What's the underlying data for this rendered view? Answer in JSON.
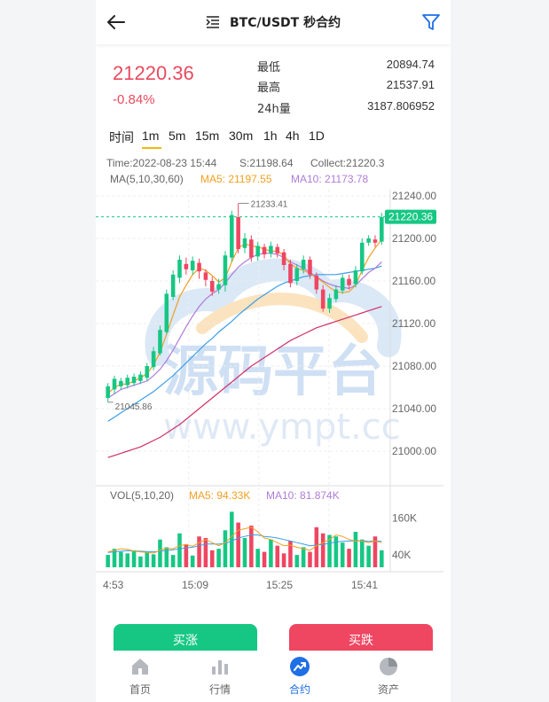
{
  "header": {
    "title": "BTC/USDT 秒合约"
  },
  "price": {
    "last": "21220.36",
    "change": "-0.84%",
    "low_label": "最低",
    "low": "20894.74",
    "high_label": "最高",
    "high": "21537.91",
    "vol_label": "24h量",
    "vol": "3187.806952"
  },
  "tabs": [
    "时间",
    "1m",
    "5m",
    "15m",
    "30m",
    "1h",
    "4h",
    "1D"
  ],
  "active_tab": "1m",
  "colors": {
    "up": "#16c784",
    "down": "#ef4662",
    "ma5": "#f0a020",
    "ma10": "#b07cd8",
    "ma30": "#3b9de8",
    "ma60": "#d0306a",
    "accent": "#1f6fe5",
    "tab_underline": "#f0b90b"
  },
  "chart_info": {
    "time": "Time:2022-08-23 15:44",
    "s": "S:21198.64",
    "collect": "Collect:21220.3",
    "ma_title": "MA(5,10,30,60)",
    "ma5": "MA5: 21197.55",
    "ma10": "MA10: 21173.78",
    "high_mark": "21233.41",
    "low_mark": "21045.86",
    "current_price_tag": "21220.36"
  },
  "chart_data": {
    "type": "candlestick",
    "y_ticks": [
      "21240.00",
      "21200.00",
      "21160.00",
      "21120.00",
      "21080.00",
      "21040.00",
      "21000.00"
    ],
    "x_ticks": [
      "4:53",
      "15:09",
      "15:25",
      "15:41"
    ],
    "ylim": [
      21000,
      21240
    ],
    "candles": [
      {
        "o": 21050,
        "c": 21061,
        "h": 21064,
        "l": 21046
      },
      {
        "o": 21058,
        "c": 21068,
        "h": 21071,
        "l": 21054
      },
      {
        "o": 21061,
        "c": 21066,
        "h": 21069,
        "l": 21058
      },
      {
        "o": 21062,
        "c": 21069,
        "h": 21072,
        "l": 21059
      },
      {
        "o": 21064,
        "c": 21070,
        "h": 21073,
        "l": 21061
      },
      {
        "o": 21066,
        "c": 21072,
        "h": 21075,
        "l": 21063
      },
      {
        "o": 21069,
        "c": 21080,
        "h": 21083,
        "l": 21066
      },
      {
        "o": 21079,
        "c": 21094,
        "h": 21098,
        "l": 21076
      },
      {
        "o": 21092,
        "c": 21114,
        "h": 21118,
        "l": 21090
      },
      {
        "o": 21112,
        "c": 21148,
        "h": 21152,
        "l": 21110
      },
      {
        "o": 21145,
        "c": 21166,
        "h": 21170,
        "l": 21142
      },
      {
        "o": 21163,
        "c": 21180,
        "h": 21184,
        "l": 21158
      },
      {
        "o": 21176,
        "c": 21171,
        "h": 21182,
        "l": 21166
      },
      {
        "o": 21170,
        "c": 21179,
        "h": 21183,
        "l": 21166
      },
      {
        "o": 21177,
        "c": 21169,
        "h": 21181,
        "l": 21162
      },
      {
        "o": 21168,
        "c": 21161,
        "h": 21171,
        "l": 21155
      },
      {
        "o": 21160,
        "c": 21150,
        "h": 21164,
        "l": 21146
      },
      {
        "o": 21152,
        "c": 21157,
        "h": 21162,
        "l": 21148
      },
      {
        "o": 21156,
        "c": 21184,
        "h": 21188,
        "l": 21150
      },
      {
        "o": 21182,
        "c": 21222,
        "h": 21226,
        "l": 21178
      },
      {
        "o": 21220,
        "c": 21190,
        "h": 21233,
        "l": 21186
      },
      {
        "o": 21191,
        "c": 21200,
        "h": 21205,
        "l": 21186
      },
      {
        "o": 21199,
        "c": 21182,
        "h": 21203,
        "l": 21178
      },
      {
        "o": 21183,
        "c": 21193,
        "h": 21197,
        "l": 21179
      },
      {
        "o": 21192,
        "c": 21185,
        "h": 21195,
        "l": 21181
      },
      {
        "o": 21186,
        "c": 21193,
        "h": 21197,
        "l": 21182
      },
      {
        "o": 21192,
        "c": 21186,
        "h": 21195,
        "l": 21182
      },
      {
        "o": 21187,
        "c": 21175,
        "h": 21190,
        "l": 21170
      },
      {
        "o": 21176,
        "c": 21158,
        "h": 21180,
        "l": 21154
      },
      {
        "o": 21160,
        "c": 21172,
        "h": 21176,
        "l": 21156
      },
      {
        "o": 21171,
        "c": 21180,
        "h": 21184,
        "l": 21167
      },
      {
        "o": 21180,
        "c": 21166,
        "h": 21183,
        "l": 21162
      },
      {
        "o": 21165,
        "c": 21152,
        "h": 21168,
        "l": 21148
      },
      {
        "o": 21152,
        "c": 21134,
        "h": 21156,
        "l": 21131
      },
      {
        "o": 21134,
        "c": 21144,
        "h": 21148,
        "l": 21130
      },
      {
        "o": 21143,
        "c": 21152,
        "h": 21156,
        "l": 21140
      },
      {
        "o": 21151,
        "c": 21163,
        "h": 21166,
        "l": 21148
      },
      {
        "o": 21162,
        "c": 21156,
        "h": 21166,
        "l": 21152
      },
      {
        "o": 21157,
        "c": 21170,
        "h": 21174,
        "l": 21154
      },
      {
        "o": 21169,
        "c": 21196,
        "h": 21200,
        "l": 21166
      },
      {
        "o": 21196,
        "c": 21200,
        "h": 21203,
        "l": 21193
      },
      {
        "o": 21199,
        "c": 21196,
        "h": 21203,
        "l": 21192
      },
      {
        "o": 21197,
        "c": 21220,
        "h": 21224,
        "l": 21194
      }
    ],
    "ma5": [
      21054,
      21060,
      21063,
      21063,
      21066,
      21069,
      21073,
      21081,
      21093,
      21110,
      21128,
      21145,
      21156,
      21166,
      21172,
      21170,
      21165,
      21159,
      21163,
      21178,
      21191,
      21195,
      21193,
      21192,
      21190,
      21188,
      21188,
      21184,
      21176,
      21172,
      21170,
      21167,
      21163,
      21159,
      21154,
      21150,
      21149,
      21150,
      21156,
      21170,
      21182,
      21191,
      21199
    ],
    "ma10": [
      21050,
      21054,
      21058,
      21060,
      21062,
      21064,
      21066,
      21071,
      21077,
      21085,
      21095,
      21106,
      21117,
      21127,
      21136,
      21143,
      21148,
      21152,
      21158,
      21166,
      21173,
      21178,
      21182,
      21185,
      21186,
      21186,
      21185,
      21182,
      21178,
      21175,
      21172,
      21168,
      21164,
      21160,
      21157,
      21155,
      21154,
      21153,
      21156,
      21162,
      21168,
      21172,
      21178
    ],
    "ma30": [
      21028,
      21032,
      21036,
      21040,
      21044,
      21048,
      21052,
      21056,
      21061,
      21066,
      21071,
      21077,
      21083,
      21089,
      21095,
      21101,
      21106,
      21112,
      21117,
      21122,
      21128,
      21133,
      21138,
      21143,
      21147,
      21151,
      21155,
      21158,
      21160,
      21162,
      21164,
      21165,
      21166,
      21166,
      21166,
      21166,
      21167,
      21168,
      21169,
      21170,
      21171,
      21172,
      21174
    ],
    "ma60": [
      20994,
      20996,
      20998,
      21000,
      21002,
      21004,
      21007,
      21010,
      21013,
      21017,
      21021,
      21025,
      21030,
      21035,
      21040,
      21045,
      21050,
      21055,
      21060,
      21065,
      21070,
      21075,
      21080,
      21084,
      21088,
      21092,
      21096,
      21100,
      21104,
      21107,
      21110,
      21113,
      21116,
      21118,
      21120,
      21122,
      21124,
      21126,
      21128,
      21130,
      21132,
      21134,
      21136
    ],
    "volume": {
      "title": "VOL(5,10,20)",
      "ma5_label": "MA5: 94.33K",
      "ma10_label": "MA10: 81.874K",
      "y_ticks": [
        "160K",
        "40K"
      ],
      "ylim": [
        0,
        230
      ],
      "values": [
        40,
        60,
        50,
        45,
        55,
        35,
        48,
        42,
        90,
        65,
        40,
        110,
        75,
        38,
        100,
        95,
        55,
        60,
        120,
        180,
        145,
        95,
        135,
        60,
        50,
        90,
        70,
        45,
        85,
        40,
        65,
        50,
        130,
        110,
        105,
        100,
        80,
        60,
        115,
        90,
        70,
        100,
        55
      ],
      "ma5": [
        50,
        55,
        60,
        58,
        52,
        50,
        48,
        46,
        55,
        62,
        60,
        70,
        74,
        68,
        80,
        90,
        80,
        70,
        80,
        100,
        120,
        125,
        130,
        115,
        95,
        90,
        80,
        70,
        72,
        65,
        60,
        55,
        70,
        80,
        90,
        105,
        100,
        90,
        85,
        85,
        80,
        85,
        80
      ],
      "ma10": [
        48,
        50,
        52,
        54,
        53,
        52,
        51,
        50,
        52,
        55,
        57,
        60,
        63,
        65,
        70,
        75,
        76,
        75,
        78,
        85,
        95,
        100,
        105,
        105,
        100,
        98,
        95,
        90,
        85,
        80,
        75,
        70,
        72,
        74,
        78,
        82,
        84,
        85,
        86,
        86,
        84,
        85,
        84
      ]
    }
  },
  "watermark": {
    "brand": "源码平台",
    "url": "www.ympt.cc"
  },
  "actions": {
    "buy": "买涨",
    "sell": "买跌"
  },
  "nav": [
    {
      "label": "首页",
      "icon": "home-icon"
    },
    {
      "label": "行情",
      "icon": "market-icon"
    },
    {
      "label": "合约",
      "icon": "contract-icon"
    },
    {
      "label": "资产",
      "icon": "assets-icon"
    }
  ],
  "nav_active": "合约"
}
